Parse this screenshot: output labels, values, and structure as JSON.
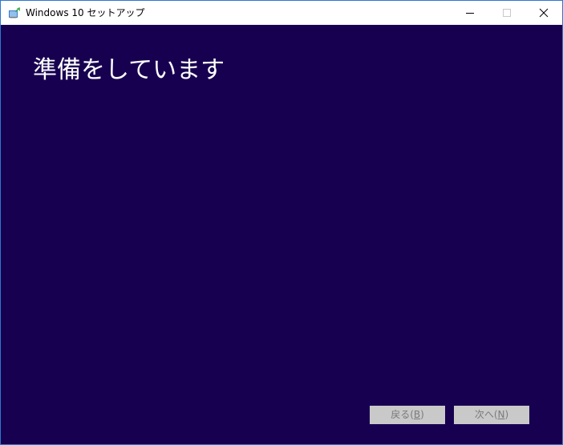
{
  "window": {
    "title": "Windows 10 セットアップ",
    "accent_color": "#2b78d4",
    "background_color": "#170050",
    "app_icon": "windows-setup-icon",
    "controls": {
      "minimize_icon": "minimize-icon",
      "maximize_icon": "maximize-icon",
      "close_icon": "close-icon",
      "maximize_enabled": false
    }
  },
  "main": {
    "heading": "準備をしています"
  },
  "footer": {
    "back_button": {
      "label_prefix": "戻る(",
      "accelerator": "B",
      "label_suffix": ")",
      "enabled": false
    },
    "next_button": {
      "label_prefix": "次へ(",
      "accelerator": "N",
      "label_suffix": ")",
      "enabled": false
    }
  }
}
